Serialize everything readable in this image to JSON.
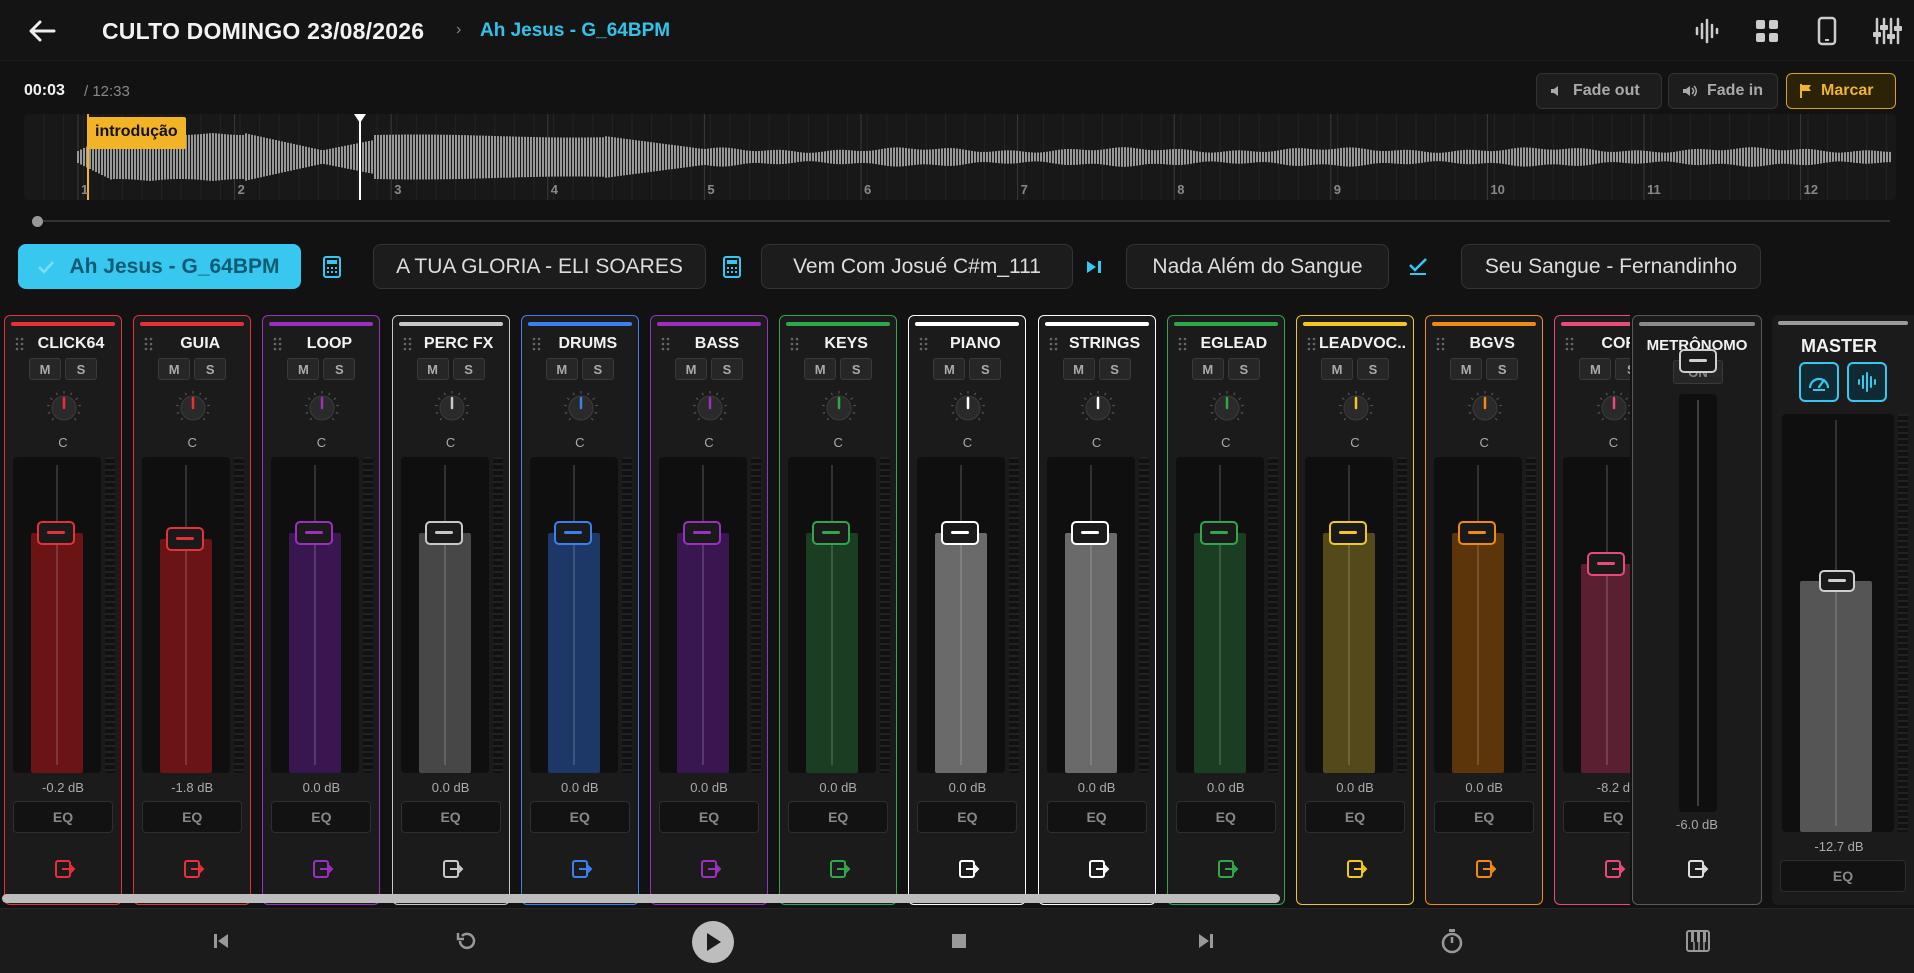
{
  "header": {
    "back_icon": "arrow-left-icon",
    "title": "CULTO DOMINGO 23/08/2026",
    "crumb_separator": "›",
    "current_song": "Ah Jesus - G_64BPM",
    "icons": [
      "waveform-icon",
      "grid-icon",
      "tablet-icon",
      "mixer-sliders-icon"
    ]
  },
  "timeline": {
    "current_time": "00:03",
    "total_time": "/ 12:33",
    "fade_out_label": "Fade out",
    "fade_in_label": "Fade in",
    "mark_label": "Marcar",
    "section_marker": "introdução",
    "bar_numbers": [
      "1",
      "2",
      "3",
      "4",
      "5",
      "6",
      "7",
      "8",
      "9",
      "10",
      "11",
      "12"
    ],
    "playhead_fraction": 0.004
  },
  "setlist": {
    "songs": [
      {
        "title": "Ah Jesus - G_64BPM",
        "active": true
      },
      {
        "title": "A TUA GLORIA - ELI SOARES",
        "active": false
      },
      {
        "title": "Vem Com Josué C#m_111",
        "active": false
      },
      {
        "title": "Nada Além do Sangue",
        "active": false
      },
      {
        "title": "Seu Sangue - Fernandinho",
        "active": false
      }
    ],
    "separator_icons": [
      "calculator-icon",
      "calculator-icon",
      "skip-next-icon",
      "check-icon"
    ]
  },
  "channels": [
    {
      "name": "CLICK64",
      "color": "#e8303a",
      "fill": "#6b1416",
      "db": "-0.2 dB",
      "level": 0.76,
      "pan": "C"
    },
    {
      "name": "GUIA",
      "color": "#e8303a",
      "fill": "#6b1416",
      "db": "-1.8 dB",
      "level": 0.74,
      "pan": "C"
    },
    {
      "name": "LOOP",
      "color": "#9a2fc0",
      "fill": "#3a1650",
      "db": "0.0 dB",
      "level": 0.76,
      "pan": "C"
    },
    {
      "name": "PERC FX",
      "color": "#c8c8c8",
      "fill": "#474747",
      "db": "0.0 dB",
      "level": 0.76,
      "pan": "C"
    },
    {
      "name": "DRUMS",
      "color": "#3b7ff0",
      "fill": "#1d3766",
      "db": "0.0 dB",
      "level": 0.76,
      "pan": "C"
    },
    {
      "name": "BASS",
      "color": "#9a2fc0",
      "fill": "#3a1650",
      "db": "0.0 dB",
      "level": 0.76,
      "pan": "C"
    },
    {
      "name": "KEYS",
      "color": "#2ea84a",
      "fill": "#1b3d22",
      "db": "0.0 dB",
      "level": 0.76,
      "pan": "C"
    },
    {
      "name": "PIANO",
      "color": "#ffffff",
      "fill": "#6a6a6a",
      "db": "0.0 dB",
      "level": 0.76,
      "pan": "C"
    },
    {
      "name": "STRINGS",
      "color": "#ffffff",
      "fill": "#6a6a6a",
      "db": "0.0 dB",
      "level": 0.76,
      "pan": "C"
    },
    {
      "name": "EGLEAD",
      "color": "#2ea84a",
      "fill": "#1b3d22",
      "db": "0.0 dB",
      "level": 0.76,
      "pan": "C"
    },
    {
      "name": "LEADVOC...",
      "color": "#f2c81e",
      "fill": "#54491a",
      "db": "0.0 dB",
      "level": 0.76,
      "pan": "C"
    },
    {
      "name": "BGVS",
      "color": "#f08a12",
      "fill": "#5c350a",
      "db": "0.0 dB",
      "level": 0.76,
      "pan": "C"
    },
    {
      "name": "CORI",
      "color": "#e84a7a",
      "fill": "#5a1f31",
      "db": "-8.2 d",
      "level": 0.66,
      "pan": "C"
    }
  ],
  "channel_labels": {
    "mute": "M",
    "solo": "S",
    "eq": "EQ",
    "output_icon": "route-output-icon",
    "drag_icon": "drag-handle-icon"
  },
  "metronome": {
    "title": "METRÔNOMO",
    "on_label": "ON",
    "db": "-6.0 dB",
    "level": 0.72
  },
  "master": {
    "title": "MASTER",
    "db": "-12.7 dB",
    "eq": "EQ",
    "level": 0.6,
    "icons": [
      "speedometer-icon",
      "waveform-icon"
    ]
  },
  "transport": {
    "icons": [
      "skip-previous-icon",
      "replay-icon",
      "play-icon",
      "stop-icon",
      "skip-next-icon",
      "timer-icon",
      "piano-icon"
    ]
  },
  "colors": {
    "accent": "#38c8ef",
    "mark": "#f0b430",
    "background": "#121212"
  }
}
